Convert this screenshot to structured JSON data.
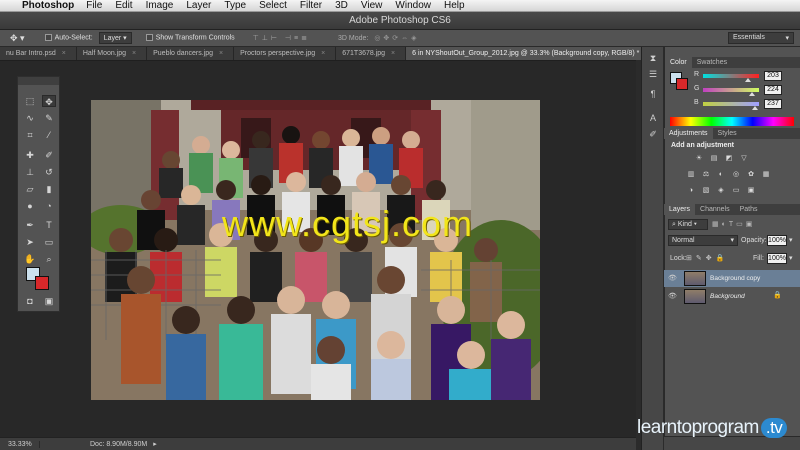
{
  "menubar": {
    "app_name": "Photoshop",
    "items": [
      "File",
      "Edit",
      "Image",
      "Layer",
      "Type",
      "Select",
      "Filter",
      "3D",
      "View",
      "Window",
      "Help"
    ]
  },
  "window": {
    "title": "Adobe Photoshop CS6"
  },
  "options_bar": {
    "auto_select_label": "Auto-Select:",
    "auto_select_value": "Layer",
    "show_transform_label": "Show Transform Controls",
    "mode_3d_label": "3D Mode:",
    "workspace_value": "Essentials"
  },
  "tabs": [
    {
      "label": "nu Bar Intro.psd"
    },
    {
      "label": "Half Moon.jpg"
    },
    {
      "label": "Pueblo dancers.jpg"
    },
    {
      "label": "Proctors perspective.jpg"
    },
    {
      "label": "671T3678.jpg"
    },
    {
      "label": "6 in NYShoutOut_Group_2012.jpg @ 33.3% (Background copy, RGB/8) *"
    }
  ],
  "watermark": "www.cgtsj.com",
  "status": {
    "zoom": "33.33%",
    "doc": "Doc: 8.90M/8.90M"
  },
  "color_panel": {
    "tabs": [
      "Color",
      "Swatches"
    ],
    "channels": [
      {
        "label": "R",
        "value": "203",
        "colors": [
          "#00e0e0",
          "#ff2020"
        ],
        "level": 0.8
      },
      {
        "label": "G",
        "value": "224",
        "colors": [
          "#c040c0",
          "#d0ff60"
        ],
        "level": 0.88
      },
      {
        "label": "B",
        "value": "237",
        "colors": [
          "#c0d040",
          "#a0a0ff"
        ],
        "level": 0.93
      }
    ],
    "fg_color": "#cbe0ed",
    "bg_color": "#d8282a"
  },
  "adjustments_panel": {
    "tabs": [
      "Adjustments",
      "Styles"
    ],
    "heading": "Add an adjustment",
    "row1": [
      "☀",
      "▤",
      "◩",
      "▽"
    ],
    "row2": [
      "▥",
      "⚖",
      "◐",
      "◎",
      "✿",
      "▦"
    ],
    "row3": [
      "◑",
      "▧",
      "◈",
      "▭",
      "▣"
    ]
  },
  "layers_panel": {
    "tabs": [
      "Layers",
      "Channels",
      "Paths"
    ],
    "kind_label": "Kind",
    "blend_mode": "Normal",
    "opacity_label": "Opacity:",
    "opacity_value": "100%",
    "lock_label": "Lock:",
    "fill_label": "Fill:",
    "fill_value": "100%",
    "layers": [
      {
        "name": "Background copy",
        "selected": true,
        "locked": false
      },
      {
        "name": "Background",
        "selected": false,
        "locked": true
      }
    ]
  },
  "brand": {
    "text": "learntoprogram",
    "tld": ".tv"
  }
}
